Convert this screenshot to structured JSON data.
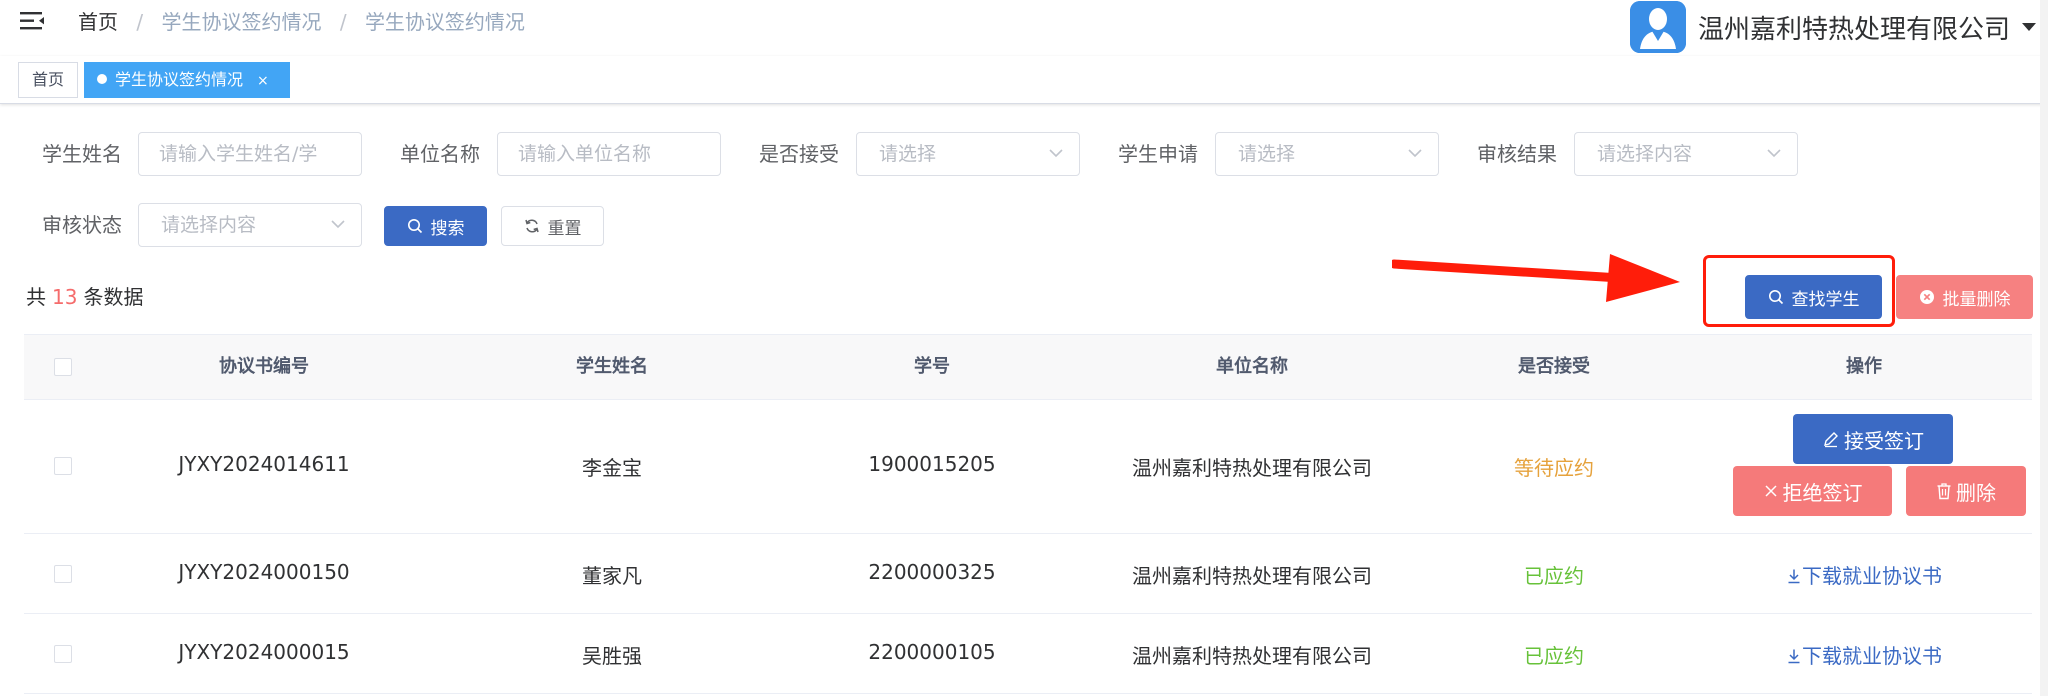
{
  "header": {
    "breadcrumb": [
      "首页",
      "学生协议签约情况",
      "学生协议签约情况"
    ],
    "separator": "/",
    "company": "温州嘉利特热处理有限公司"
  },
  "tags": {
    "home": "首页",
    "active": "学生协议签约情况",
    "close": "×"
  },
  "filters": {
    "student_name": {
      "label": "学生姓名",
      "placeholder": "请输入学生姓名/学"
    },
    "unit_name": {
      "label": "单位名称",
      "placeholder": "请输入单位名称"
    },
    "accepted": {
      "label": "是否接受",
      "placeholder": "请选择"
    },
    "student_apply": {
      "label": "学生申请",
      "placeholder": "请选择"
    },
    "review_result": {
      "label": "审核结果",
      "placeholder": "请选择内容"
    },
    "review_status": {
      "label": "审核状态",
      "placeholder": "请选择内容"
    },
    "search_label": "搜索",
    "reset_label": "重置"
  },
  "summary": {
    "prefix": "共",
    "count": "13",
    "suffix": "条数据"
  },
  "toolbar": {
    "find_student": "查找学生",
    "batch_delete": "批量删除"
  },
  "table": {
    "columns": [
      "协议书编号",
      "学生姓名",
      "学号",
      "单位名称",
      "是否接受",
      "操作"
    ],
    "rows": [
      {
        "agreement_no": "JYXY2024014611",
        "name": "李金宝",
        "student_id": "1900015205",
        "unit": "温州嘉利特热处理有限公司",
        "accepted": "等待应约",
        "status": "wait"
      },
      {
        "agreement_no": "JYXY2024000150",
        "name": "董家凡",
        "student_id": "2200000325",
        "unit": "温州嘉利特热处理有限公司",
        "accepted": "已应约",
        "status": "ok"
      },
      {
        "agreement_no": "JYXY2024000015",
        "name": "吴胜强",
        "student_id": "2200000105",
        "unit": "温州嘉利特热处理有限公司",
        "accepted": "已应约",
        "status": "ok"
      }
    ],
    "actions": {
      "accept": "接受签订",
      "reject": "拒绝签订",
      "delete": "删除",
      "download": "下载就业协议书"
    }
  },
  "colors": {
    "primary": "#3b6ac4",
    "danger": "#f56c6c",
    "warning": "#e6a23c",
    "success": "#67c23a",
    "tag_active": "#42a5f5",
    "annotation": "#ff1d0a"
  }
}
